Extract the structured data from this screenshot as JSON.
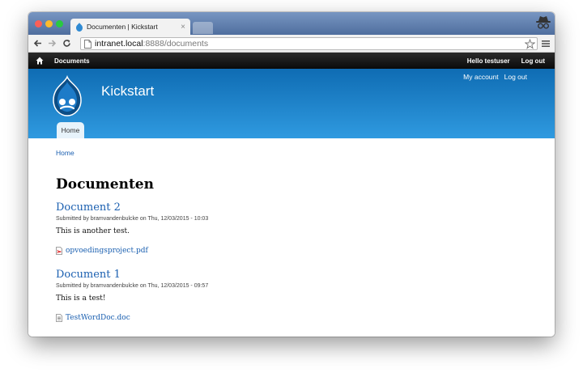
{
  "browser": {
    "tab_title": "Documenten | Kickstart",
    "tab_close": "×",
    "url_host": "intranet.local",
    "url_path": ":8888/documents"
  },
  "adminbar": {
    "home_label": "Documents",
    "hello_prefix": "Hello ",
    "username": "testuser",
    "logout": "Log out"
  },
  "header": {
    "site_name": "Kickstart",
    "secondary_menu": [
      "My account",
      "Log out"
    ],
    "main_tab": "Home"
  },
  "content": {
    "breadcrumb": "Home",
    "page_title": "Documenten",
    "documents": [
      {
        "title": "Document 2",
        "submitted": "Submitted by bramvandenbulcke on Thu, 12/03/2015 - 10:03",
        "body": "This is another test.",
        "file": "opvoedingsproject.pdf",
        "file_type": "pdf"
      },
      {
        "title": "Document 1",
        "submitted": "Submitted by bramvandenbulcke on Thu, 12/03/2015 - 09:57",
        "body": "This is a test!",
        "file": "TestWordDoc.doc",
        "file_type": "doc"
      }
    ]
  },
  "colors": {
    "link": "#1a5fb0",
    "header_top": "#0f6cb3",
    "header_bottom": "#2f9ae0",
    "adminbar": "#111111"
  },
  "icons": [
    "home-icon",
    "drupal-logo-icon",
    "pdf-file-icon",
    "doc-file-icon",
    "back-icon",
    "forward-icon",
    "reload-icon",
    "star-icon",
    "menu-icon",
    "incognito-icon"
  ]
}
